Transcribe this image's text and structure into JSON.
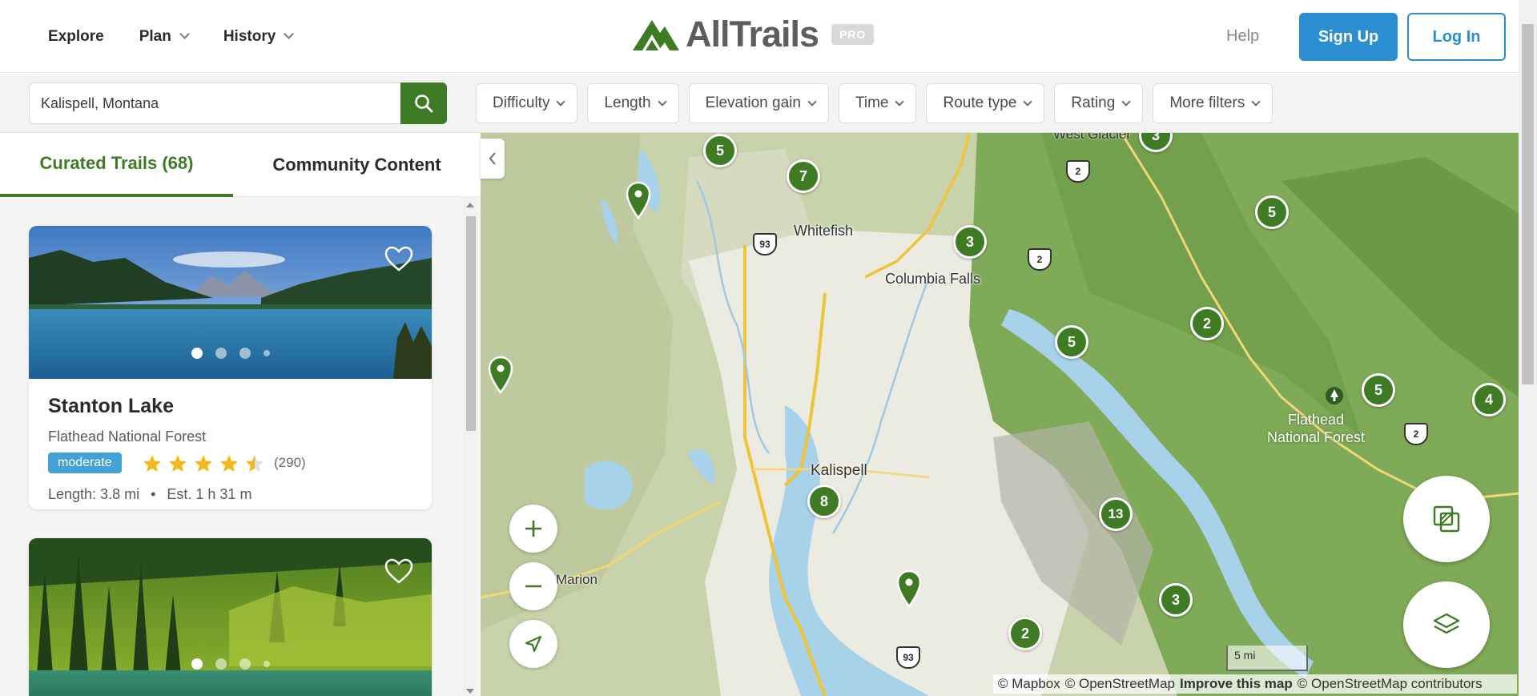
{
  "header": {
    "nav": [
      {
        "label": "Explore",
        "has_dropdown": false
      },
      {
        "label": "Plan",
        "has_dropdown": true
      },
      {
        "label": "History",
        "has_dropdown": true
      }
    ],
    "logo_text": "AllTrails",
    "pro_badge": "PRO",
    "help": "Help",
    "signup": "Sign Up",
    "login": "Log In",
    "brand_color": "#3f7b25",
    "accent_blue": "#2a8ed0"
  },
  "search": {
    "value": "Kalispell, Montana",
    "button_icon": "search-icon"
  },
  "filters": [
    "Difficulty",
    "Length",
    "Elevation gain",
    "Time",
    "Route type",
    "Rating",
    "More filters"
  ],
  "panel": {
    "tabs": [
      {
        "label": "Curated Trails (68)",
        "active": true
      },
      {
        "label": "Community Content",
        "active": false
      }
    ],
    "trails": [
      {
        "name": "Stanton Lake",
        "area": "Flathead National Forest",
        "difficulty": "moderate",
        "rating": 4.5,
        "reviews": "(290)",
        "length": "Length: 3.8 mi",
        "separator": "•",
        "time": "Est. 1 h 31 m"
      }
    ]
  },
  "map": {
    "labels": {
      "west_glacier": "West Glacier",
      "whitefish": "Whitefish",
      "columbia_falls": "Columbia Falls",
      "kalispell": "Kalispell",
      "marion": "Marion",
      "flathead_nf": "Flathead",
      "flathead_nf_2": "National Forest"
    },
    "route_shields": {
      "us93": "93",
      "us2": "2"
    },
    "clusters": [
      "5",
      "7",
      "3",
      "3",
      "5",
      "2",
      "5",
      "5",
      "4",
      "8",
      "13",
      "3",
      "2"
    ],
    "scale": "5 mi",
    "attribution": {
      "mapbox": "© Mapbox",
      "osm": "© OpenStreetMap",
      "improve": "Improve this map",
      "osm_contrib": "© OpenStreetMap contributors"
    }
  }
}
